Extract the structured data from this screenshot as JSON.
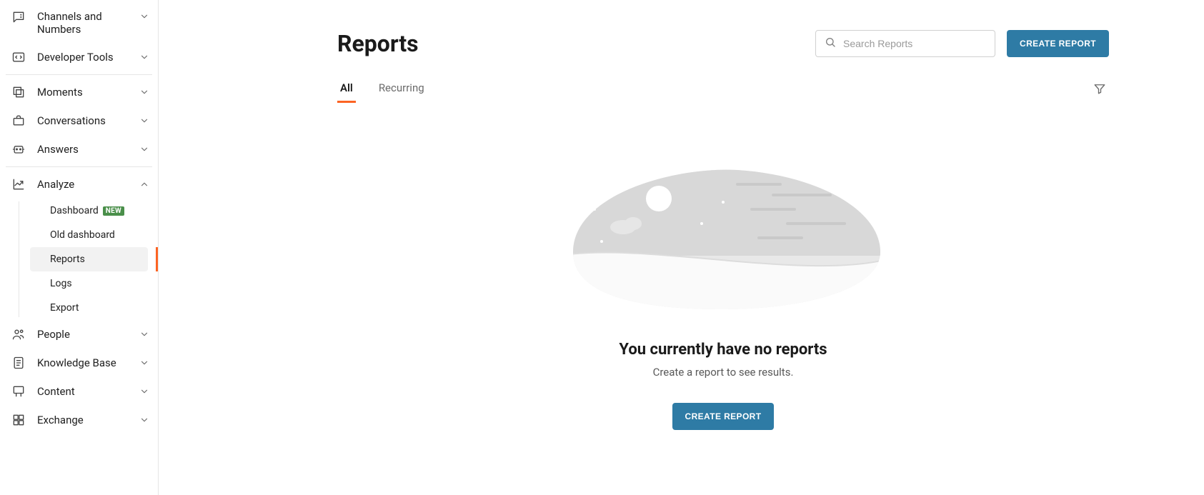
{
  "sidebar": {
    "channels_label": "Channels and Numbers",
    "devtools_label": "Developer Tools",
    "moments_label": "Moments",
    "conversations_label": "Conversations",
    "answers_label": "Answers",
    "analyze_label": "Analyze",
    "people_label": "People",
    "kb_label": "Knowledge Base",
    "content_label": "Content",
    "exchange_label": "Exchange",
    "analyze_sub": {
      "dashboard_label": "Dashboard",
      "dashboard_badge": "NEW",
      "old_dashboard_label": "Old dashboard",
      "reports_label": "Reports",
      "logs_label": "Logs",
      "export_label": "Export"
    }
  },
  "page": {
    "title": "Reports",
    "search_placeholder": "Search Reports",
    "create_button": "CREATE REPORT",
    "tabs": {
      "all": "All",
      "recurring": "Recurring"
    },
    "empty": {
      "title": "You currently have no reports",
      "subtitle": "Create a report to see results.",
      "cta": "CREATE REPORT"
    }
  },
  "colors": {
    "accent_orange": "#fc6423",
    "primary_blue": "#2e7ba5",
    "badge_green": "#4a8f4a"
  }
}
